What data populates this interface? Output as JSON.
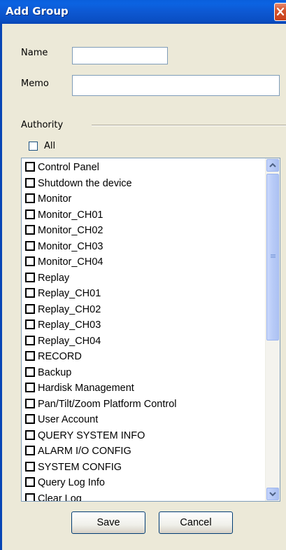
{
  "window": {
    "title": "Add Group"
  },
  "form": {
    "name_label": "Name",
    "name_value": "",
    "memo_label": "Memo",
    "memo_value": "",
    "authority_label": "Authority",
    "all_label": "All",
    "all_checked": false
  },
  "permissions": [
    {
      "label": "Control Panel",
      "checked": false
    },
    {
      "label": "Shutdown the device",
      "checked": false
    },
    {
      "label": "Monitor",
      "checked": false
    },
    {
      "label": "Monitor_CH01",
      "checked": false
    },
    {
      "label": "Monitor_CH02",
      "checked": false
    },
    {
      "label": "Monitor_CH03",
      "checked": false
    },
    {
      "label": "Monitor_CH04",
      "checked": false
    },
    {
      "label": "Replay",
      "checked": false
    },
    {
      "label": "Replay_CH01",
      "checked": false
    },
    {
      "label": "Replay_CH02",
      "checked": false
    },
    {
      "label": "Replay_CH03",
      "checked": false
    },
    {
      "label": "Replay_CH04",
      "checked": false
    },
    {
      "label": "RECORD",
      "checked": false
    },
    {
      "label": "Backup",
      "checked": false
    },
    {
      "label": "Hardisk Management",
      "checked": false
    },
    {
      "label": "Pan/Tilt/Zoom Platform Control",
      "checked": false
    },
    {
      "label": "User Account",
      "checked": false
    },
    {
      "label": "QUERY SYSTEM INFO",
      "checked": false
    },
    {
      "label": "ALARM I/O CONFIG",
      "checked": false
    },
    {
      "label": "SYSTEM CONFIG",
      "checked": false
    },
    {
      "label": "Query Log Info",
      "checked": false
    },
    {
      "label": "Clear Log",
      "checked": false
    }
  ],
  "buttons": {
    "save_label": "Save",
    "cancel_label": "Cancel"
  },
  "icons": {
    "close": "close-icon",
    "scroll_up": "chevron-up-icon",
    "scroll_down": "chevron-down-icon"
  },
  "colors": {
    "titlebar": "#0a58d0",
    "close_button": "#d4542e",
    "dialog_bg": "#ece9d8"
  }
}
